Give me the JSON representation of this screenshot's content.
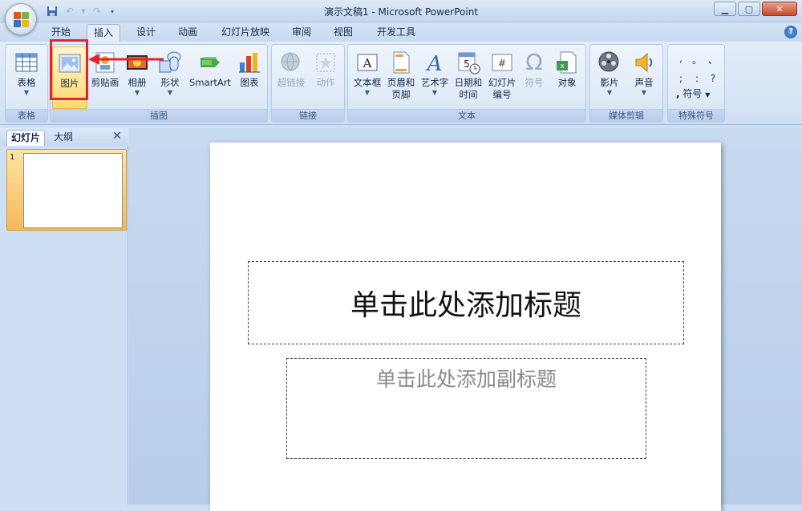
{
  "window": {
    "title": "演示文稿1 - Microsoft PowerPoint"
  },
  "tabs": [
    "开始",
    "插入",
    "设计",
    "动画",
    "幻灯片放映",
    "审阅",
    "视图",
    "开发工具"
  ],
  "active_tab": "插入",
  "ribbon": {
    "groups": {
      "table": {
        "label": "表格",
        "buttons": [
          {
            "label": "表格"
          }
        ]
      },
      "illustrations": {
        "label": "插图",
        "buttons": [
          {
            "label": "图片"
          },
          {
            "label": "剪贴画"
          },
          {
            "label": "相册"
          },
          {
            "label": "形状"
          },
          {
            "label": "SmartArt"
          },
          {
            "label": "图表"
          }
        ]
      },
      "links": {
        "label": "链接",
        "buttons": [
          {
            "label": "超链接"
          },
          {
            "label": "动作"
          }
        ]
      },
      "text": {
        "label": "文本",
        "buttons": [
          {
            "label": "文本框"
          },
          {
            "label": "页眉和",
            "label2": "页脚"
          },
          {
            "label": "艺术字"
          },
          {
            "label": "日期和",
            "label2": "时间"
          },
          {
            "label": "幻灯片",
            "label2": "编号"
          },
          {
            "label": "符号"
          },
          {
            "label": "对象"
          }
        ]
      },
      "media": {
        "label": "媒体剪辑",
        "buttons": [
          {
            "label": "影片"
          },
          {
            "label": "声音"
          }
        ]
      },
      "special_symbols": {
        "label": "特殊符号",
        "button": "符号",
        "symbols": [
          ",",
          "。",
          "、",
          ";",
          ":",
          "?"
        ]
      }
    }
  },
  "left_pane": {
    "tabs": [
      "幻灯片",
      "大纲"
    ],
    "slide_number": "1"
  },
  "slide": {
    "title_placeholder": "单击此处添加标题",
    "subtitle_placeholder": "单击此处添加副标题"
  },
  "colors": {
    "highlight": "#e3232d",
    "ribbon_bg": "#dfeaf7",
    "workspace_bg": "#c8daf0"
  }
}
